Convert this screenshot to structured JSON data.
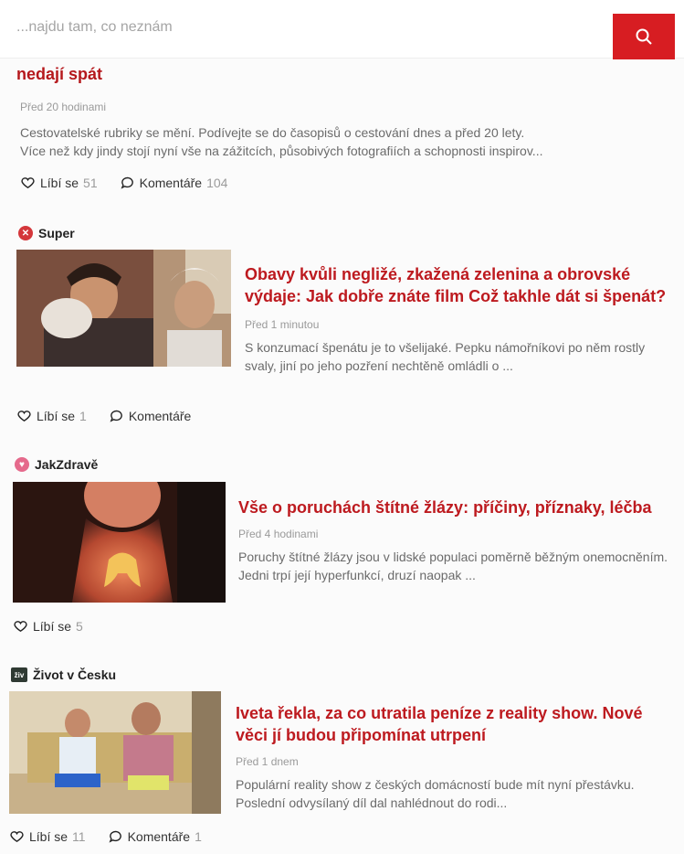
{
  "search": {
    "placeholder": "...najdu tam, co neznám"
  },
  "first_article": {
    "title": "nedají spát",
    "time": "Před 20 hodinami",
    "perex_1": "Cestovatelské rubriky se mění. Podívejte se do časopisů o cestování dnes a před 20 lety.",
    "perex_2": "Více než kdy jindy stojí nyní vše na zážitcích, působivých fotografiích a schopnosti inspirov...",
    "likes_label": "Líbí se",
    "likes": "51",
    "comments_label": "Komentáře",
    "comments": "104"
  },
  "articles": [
    {
      "source": "Super",
      "title": "Obavy kvůli negližé, zkažená zelenina a obrovské výdaje: Jak dobře znáte film Což takhle dát si špenát?",
      "time": "Před 1 minutou",
      "perex": "S konzumací špenátu je to všelijaké. Pepku námořníkovi po něm rostly svaly, jiní po jeho pozření nechtěně omládli o ...",
      "likes_label": "Líbí se",
      "likes": "1",
      "comments_label": "Komentáře",
      "comments": ""
    },
    {
      "source": "JakZdravě",
      "title": "Vše o poruchách štítné žlázy: příčiny, příznaky, léčba",
      "time": "Před 4 hodinami",
      "perex": "Poruchy štítné žlázy jsou v lidské populaci poměrně běžným onemocněním. Jedni trpí její hyperfunkcí, druzí naopak ...",
      "likes_label": "Líbí se",
      "likes": "5"
    },
    {
      "source": "Život v Česku",
      "source_badge": "živ",
      "title": "Iveta řekla, za co utratila peníze z reality show. Nové věci jí budou připomínat utrpení",
      "time": "Před 1 dnem",
      "perex": "Populární reality show z českých domácností bude mít nyní přestávku. Poslední odvysílaný díl dal nahlédnout do rodi...",
      "likes_label": "Líbí se",
      "likes": "11",
      "comments_label": "Komentáře",
      "comments": "1"
    }
  ],
  "colors": {
    "accent": "#d71d22",
    "title": "#bd1a1f"
  },
  "icons": [
    "search-icon",
    "heart-icon",
    "comment-icon"
  ]
}
